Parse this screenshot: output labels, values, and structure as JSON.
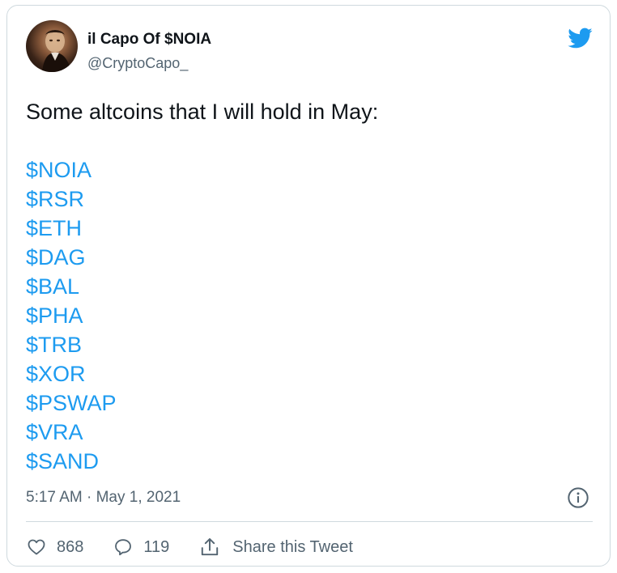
{
  "author": {
    "name": "il Capo Of $NOIA",
    "handle": "@CryptoCapo_"
  },
  "tweet": {
    "text": "Some altcoins that I will hold in May:",
    "tickers": [
      "$NOIA",
      "$RSR",
      "$ETH",
      "$DAG",
      "$BAL",
      "$PHA",
      "$TRB",
      "$XOR",
      "$PSWAP",
      "$VRA",
      "$SAND"
    ],
    "timestamp": "5:17 AM · May 1, 2021"
  },
  "actions": {
    "likes": "868",
    "replies": "119",
    "share_label": "Share this Tweet"
  },
  "colors": {
    "link": "#1d9bf0",
    "muted": "#536471",
    "text": "#0f1419",
    "border": "#cfd9de"
  },
  "icons": {
    "brand": "twitter-bird-icon",
    "info": "info-icon",
    "like": "heart-icon",
    "reply": "reply-bubble-icon",
    "share": "share-upload-icon"
  }
}
